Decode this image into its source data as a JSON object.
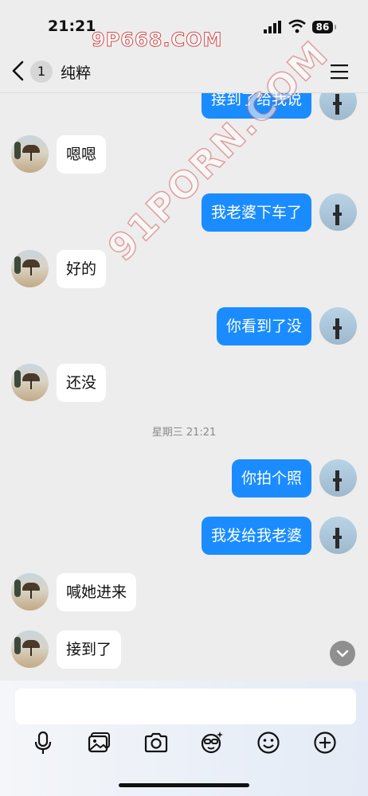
{
  "status": {
    "time": "21:21",
    "battery": "86"
  },
  "watermarks": {
    "top": "9P668.COM",
    "diagonal": "91PORN.COM"
  },
  "nav": {
    "unread_count": "1",
    "title": "纯粹"
  },
  "messages": [
    {
      "side": "out",
      "text": "接到了给我说"
    },
    {
      "side": "in",
      "text": "嗯嗯"
    },
    {
      "side": "out",
      "text": "我老婆下车了"
    },
    {
      "side": "in",
      "text": "好的"
    },
    {
      "side": "out",
      "text": "你看到了没"
    },
    {
      "side": "in",
      "text": "还没"
    },
    {
      "side": "out",
      "text": "你拍个照"
    },
    {
      "side": "out",
      "text": "我发给我老婆"
    },
    {
      "side": "in",
      "text": "喊她进来"
    },
    {
      "side": "in",
      "text": "接到了"
    }
  ],
  "timestamp": "星期三 21:21",
  "input": {
    "value": "",
    "placeholder": ""
  },
  "toolbar": [
    "microphone-icon",
    "image-icon",
    "camera-icon",
    "sticker-icon",
    "emoji-icon",
    "add-icon"
  ],
  "colors": {
    "outgoing_bubble": "#1a8cff",
    "incoming_bubble": "#ffffff",
    "background": "#ededed"
  }
}
